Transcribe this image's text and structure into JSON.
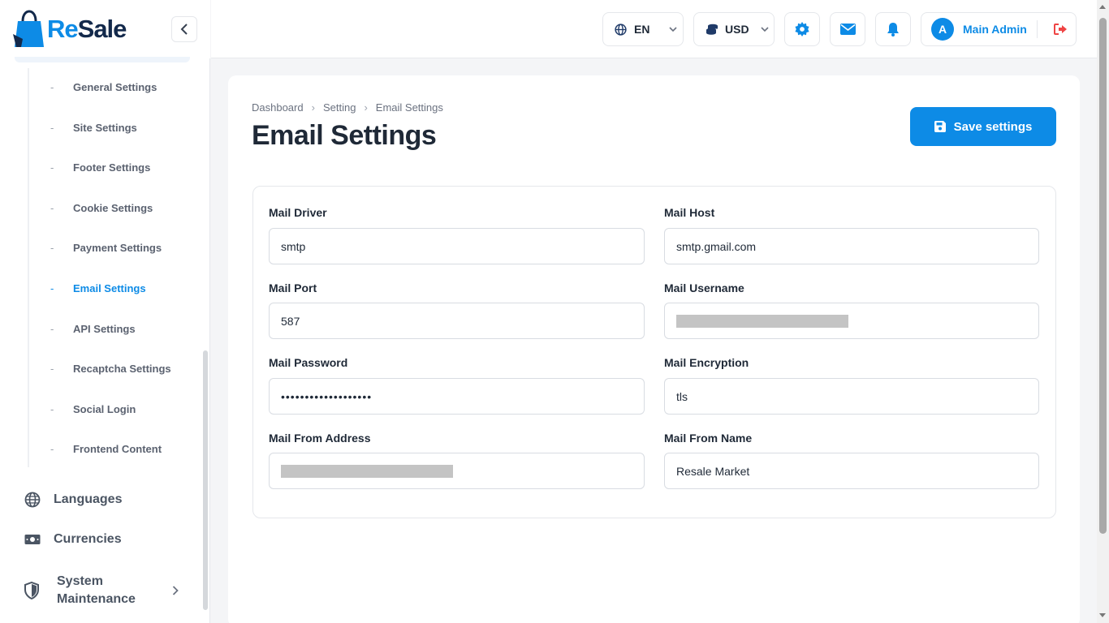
{
  "brand": {
    "logo_prefix": "Re",
    "logo_suffix": "Sale"
  },
  "sidebar": {
    "sub_items": [
      {
        "label": "General Settings"
      },
      {
        "label": "Site Settings"
      },
      {
        "label": "Footer Settings"
      },
      {
        "label": "Cookie Settings"
      },
      {
        "label": "Payment Settings"
      },
      {
        "label": "Email Settings",
        "active": true
      },
      {
        "label": "API Settings"
      },
      {
        "label": "Recaptcha Settings"
      },
      {
        "label": "Social Login"
      },
      {
        "label": "Frontend Content"
      }
    ],
    "dash": "-",
    "languages": "Languages",
    "currencies": "Currencies",
    "system_maintenance_line1": "System",
    "system_maintenance_line2": "Maintenance"
  },
  "topbar": {
    "language": "EN",
    "currency": "USD",
    "avatar_initial": "A",
    "user_name": "Main Admin"
  },
  "page": {
    "breadcrumb": [
      "Dashboard",
      "Setting",
      "Email Settings"
    ],
    "breadcrumb_sep": "›",
    "title": "Email Settings",
    "save_label": "Save settings"
  },
  "form": {
    "mail_driver": {
      "label": "Mail Driver",
      "value": "smtp"
    },
    "mail_host": {
      "label": "Mail Host",
      "value": "smtp.gmail.com"
    },
    "mail_port": {
      "label": "Mail Port",
      "value": "587"
    },
    "mail_username": {
      "label": "Mail Username",
      "value": ""
    },
    "mail_password": {
      "label": "Mail Password",
      "value": "•••••••••••••••••••"
    },
    "mail_encryption": {
      "label": "Mail Encryption",
      "value": "tls"
    },
    "mail_from_address": {
      "label": "Mail From Address",
      "value": ""
    },
    "mail_from_name": {
      "label": "Mail From Name",
      "value": "Resale Market"
    }
  },
  "colors": {
    "accent": "#0d8be6",
    "logout": "#ef4444"
  }
}
